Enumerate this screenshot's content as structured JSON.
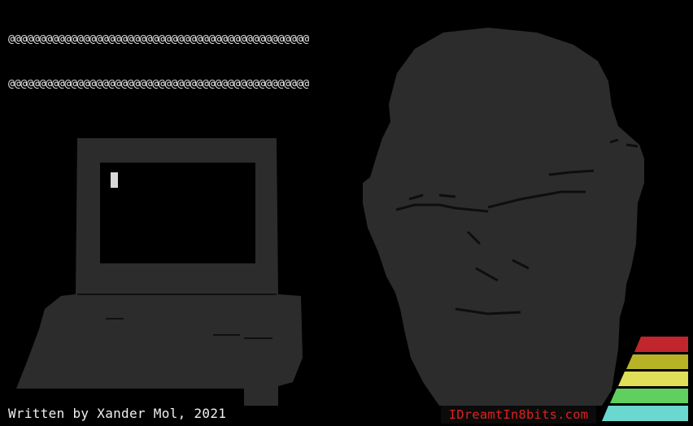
{
  "top_block": {
    "rows": [
      "@@@@@@@@@@@@@@@@@@@@@@@@@@@@@@@@@@@@@@@@@@@@@@@@",
      "@@@@@@@@@@@@@@@@@@@@@@@@@@@@@@@@@@@@@@@@@@@@@@@@",
      "@@@@@@@@@@@@@@@@@@@@@@@@@@@@@@@@@@@@@@@@@@@@@@@@",
      "@@@@@@@@@@@@@@@@@@@@@@@@@@@@@@@@@@@@@@@@@@@@@@@@",
      "@@@@@@@@@@@@@@@@@@@@@@@@@@@@@@@@@@@@@@@@@@@@@@@@",
      "@@@@@@@@@@@@@@@@@@@@@@@@@@@@@@@@@@@@@@@@@@@@@@@@",
      "@@@@@@@@@@@@@@@@@@@@@@@@@@@@@@@@@@@@@@@@@@@@@@@@",
      "@@@@@@@@@@@@@@@@@@@@@@@@@@@@@@@@@@@@@@@@@@@@@@@@"
    ]
  },
  "footer": {
    "credit": "Written by Xander Mol, 2021",
    "website": "IDreamtIn8bits.com"
  },
  "colors": {
    "art_fill": "#2c2c2c",
    "art_detail": "#101010",
    "text": "#f0f0f0",
    "website_text": "#e02020",
    "stripes": [
      "#c0262b",
      "#b7b325",
      "#dfdf58",
      "#5fcf5f",
      "#6ad8cf"
    ]
  },
  "icons": [
    "computer-icon",
    "portrait-art",
    "cursor-icon"
  ]
}
